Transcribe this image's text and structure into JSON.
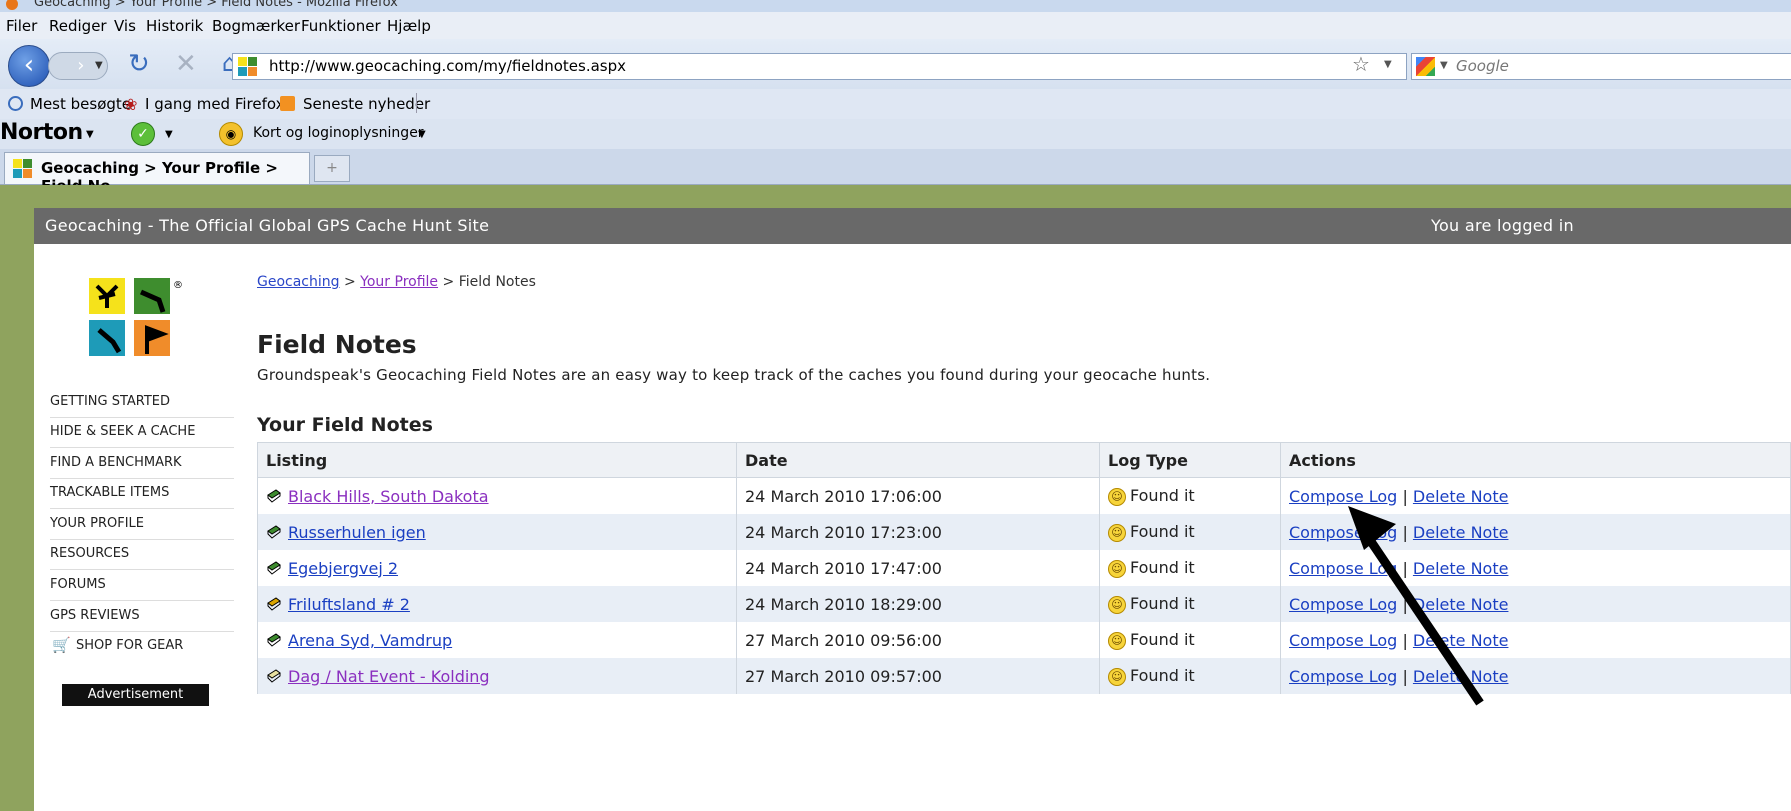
{
  "window": {
    "title": "Geocaching > Your Profile > Field Notes - Mozilla Firefox"
  },
  "menu": [
    "Filer",
    "Rediger",
    "Vis",
    "Historik",
    "Bogmærker",
    "Funktioner",
    "Hjælp"
  ],
  "nav": {
    "url": "http://www.geocaching.com/my/fieldnotes.aspx",
    "search_placeholder": "Google"
  },
  "bookmarks": [
    "Mest besøgte",
    "I gang med Firefox",
    "Seneste nyheder"
  ],
  "norton": {
    "logo": "Norton",
    "login_label": "Kort og loginoplysninger"
  },
  "tab": {
    "label": "Geocaching > Your Profile > Field No..."
  },
  "site": {
    "banner": "Geocaching - The Official Global GPS Cache Hunt Site",
    "login_status": "You are logged in"
  },
  "sidenav": [
    "GETTING STARTED",
    "HIDE & SEEK A CACHE",
    "FIND A BENCHMARK",
    "TRACKABLE ITEMS",
    "YOUR PROFILE",
    "RESOURCES",
    "FORUMS",
    "GPS REVIEWS",
    "SHOP FOR GEAR"
  ],
  "ad_label": "Advertisement",
  "breadcrumb": {
    "home": "Geocaching",
    "sep": ">",
    "profile": "Your Profile",
    "current": "Field Notes"
  },
  "page": {
    "title": "Field Notes",
    "description": "Groundspeak's Geocaching Field Notes are an easy way to keep track of the caches you found during your geocache hunts.",
    "section_title": "Your Field Notes"
  },
  "table": {
    "headers": [
      "Listing",
      "Date",
      "Log Type",
      "Actions"
    ],
    "rows": [
      {
        "listing": "Black Hills, South Dakota",
        "date": "24 March 2010 17:06:00",
        "log_type": "Found it",
        "visited": true,
        "icon": "traditional-cache-icon"
      },
      {
        "listing": "Russerhulen igen",
        "date": "24 March 2010 17:23:00",
        "log_type": "Found it",
        "visited": false,
        "icon": "traditional-cache-icon"
      },
      {
        "listing": "Egebjergvej 2",
        "date": "24 March 2010 17:47:00",
        "log_type": "Found it",
        "visited": false,
        "icon": "traditional-cache-icon"
      },
      {
        "listing": "Friluftsland # 2",
        "date": "24 March 2010 18:29:00",
        "log_type": "Found it",
        "visited": false,
        "icon": "multi-cache-icon"
      },
      {
        "listing": "Arena Syd, Vamdrup",
        "date": "27 March 2010 09:56:00",
        "log_type": "Found it",
        "visited": false,
        "icon": "traditional-cache-icon"
      },
      {
        "listing": "Dag / Nat Event - Kolding",
        "date": "27 March 2010 09:57:00",
        "log_type": "Found it",
        "visited": true,
        "icon": "event-cache-icon"
      }
    ],
    "action_compose": "Compose Log",
    "action_sep": "|",
    "action_delete": "Delete Note"
  },
  "colors": {
    "site_bg": "#8fa35e",
    "banner_bg": "#696969",
    "link": "#1a3fc2",
    "visited_link": "#8a2fbf",
    "row_alt": "#e8eef6"
  }
}
